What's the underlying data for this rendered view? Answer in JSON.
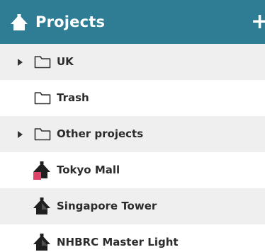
{
  "header": {
    "title": "Projects",
    "add_label": "+",
    "logo_icon": "house-project-icon",
    "background": "#2e7d95"
  },
  "tree": {
    "items": [
      {
        "label": "UK",
        "kind": "folder",
        "expandable": true,
        "icon": "folder-icon"
      },
      {
        "label": "Trash",
        "kind": "folder",
        "expandable": false,
        "icon": "folder-icon"
      },
      {
        "label": "Other projects",
        "kind": "folder",
        "expandable": true,
        "icon": "folder-icon"
      },
      {
        "label": "Tokyo Mall",
        "kind": "project",
        "icon": "building-icon",
        "badge_color": "#e0436a"
      },
      {
        "label": "Singapore Tower",
        "kind": "project",
        "icon": "building-icon"
      },
      {
        "label": "NHBRC Master Light",
        "kind": "project",
        "icon": "building-icon"
      }
    ]
  }
}
